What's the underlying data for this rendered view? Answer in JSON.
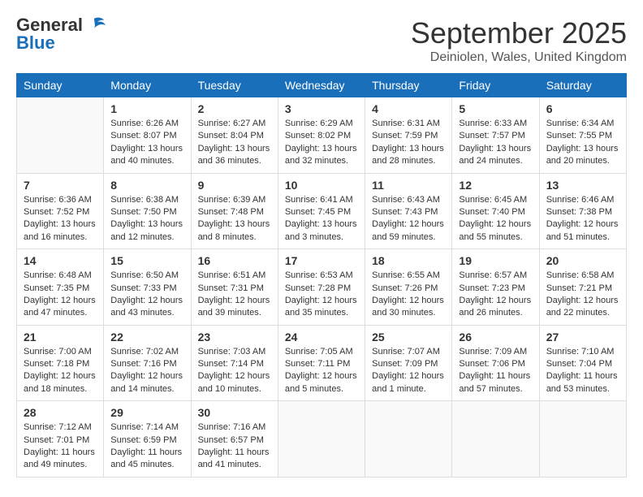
{
  "header": {
    "logo_general": "General",
    "logo_blue": "Blue",
    "month_title": "September 2025",
    "location": "Deiniolen, Wales, United Kingdom"
  },
  "days_of_week": [
    "Sunday",
    "Monday",
    "Tuesday",
    "Wednesday",
    "Thursday",
    "Friday",
    "Saturday"
  ],
  "weeks": [
    [
      {
        "day": "",
        "info": ""
      },
      {
        "day": "1",
        "info": "Sunrise: 6:26 AM\nSunset: 8:07 PM\nDaylight: 13 hours\nand 40 minutes."
      },
      {
        "day": "2",
        "info": "Sunrise: 6:27 AM\nSunset: 8:04 PM\nDaylight: 13 hours\nand 36 minutes."
      },
      {
        "day": "3",
        "info": "Sunrise: 6:29 AM\nSunset: 8:02 PM\nDaylight: 13 hours\nand 32 minutes."
      },
      {
        "day": "4",
        "info": "Sunrise: 6:31 AM\nSunset: 7:59 PM\nDaylight: 13 hours\nand 28 minutes."
      },
      {
        "day": "5",
        "info": "Sunrise: 6:33 AM\nSunset: 7:57 PM\nDaylight: 13 hours\nand 24 minutes."
      },
      {
        "day": "6",
        "info": "Sunrise: 6:34 AM\nSunset: 7:55 PM\nDaylight: 13 hours\nand 20 minutes."
      }
    ],
    [
      {
        "day": "7",
        "info": "Sunrise: 6:36 AM\nSunset: 7:52 PM\nDaylight: 13 hours\nand 16 minutes."
      },
      {
        "day": "8",
        "info": "Sunrise: 6:38 AM\nSunset: 7:50 PM\nDaylight: 13 hours\nand 12 minutes."
      },
      {
        "day": "9",
        "info": "Sunrise: 6:39 AM\nSunset: 7:48 PM\nDaylight: 13 hours\nand 8 minutes."
      },
      {
        "day": "10",
        "info": "Sunrise: 6:41 AM\nSunset: 7:45 PM\nDaylight: 13 hours\nand 3 minutes."
      },
      {
        "day": "11",
        "info": "Sunrise: 6:43 AM\nSunset: 7:43 PM\nDaylight: 12 hours\nand 59 minutes."
      },
      {
        "day": "12",
        "info": "Sunrise: 6:45 AM\nSunset: 7:40 PM\nDaylight: 12 hours\nand 55 minutes."
      },
      {
        "day": "13",
        "info": "Sunrise: 6:46 AM\nSunset: 7:38 PM\nDaylight: 12 hours\nand 51 minutes."
      }
    ],
    [
      {
        "day": "14",
        "info": "Sunrise: 6:48 AM\nSunset: 7:35 PM\nDaylight: 12 hours\nand 47 minutes."
      },
      {
        "day": "15",
        "info": "Sunrise: 6:50 AM\nSunset: 7:33 PM\nDaylight: 12 hours\nand 43 minutes."
      },
      {
        "day": "16",
        "info": "Sunrise: 6:51 AM\nSunset: 7:31 PM\nDaylight: 12 hours\nand 39 minutes."
      },
      {
        "day": "17",
        "info": "Sunrise: 6:53 AM\nSunset: 7:28 PM\nDaylight: 12 hours\nand 35 minutes."
      },
      {
        "day": "18",
        "info": "Sunrise: 6:55 AM\nSunset: 7:26 PM\nDaylight: 12 hours\nand 30 minutes."
      },
      {
        "day": "19",
        "info": "Sunrise: 6:57 AM\nSunset: 7:23 PM\nDaylight: 12 hours\nand 26 minutes."
      },
      {
        "day": "20",
        "info": "Sunrise: 6:58 AM\nSunset: 7:21 PM\nDaylight: 12 hours\nand 22 minutes."
      }
    ],
    [
      {
        "day": "21",
        "info": "Sunrise: 7:00 AM\nSunset: 7:18 PM\nDaylight: 12 hours\nand 18 minutes."
      },
      {
        "day": "22",
        "info": "Sunrise: 7:02 AM\nSunset: 7:16 PM\nDaylight: 12 hours\nand 14 minutes."
      },
      {
        "day": "23",
        "info": "Sunrise: 7:03 AM\nSunset: 7:14 PM\nDaylight: 12 hours\nand 10 minutes."
      },
      {
        "day": "24",
        "info": "Sunrise: 7:05 AM\nSunset: 7:11 PM\nDaylight: 12 hours\nand 5 minutes."
      },
      {
        "day": "25",
        "info": "Sunrise: 7:07 AM\nSunset: 7:09 PM\nDaylight: 12 hours\nand 1 minute."
      },
      {
        "day": "26",
        "info": "Sunrise: 7:09 AM\nSunset: 7:06 PM\nDaylight: 11 hours\nand 57 minutes."
      },
      {
        "day": "27",
        "info": "Sunrise: 7:10 AM\nSunset: 7:04 PM\nDaylight: 11 hours\nand 53 minutes."
      }
    ],
    [
      {
        "day": "28",
        "info": "Sunrise: 7:12 AM\nSunset: 7:01 PM\nDaylight: 11 hours\nand 49 minutes."
      },
      {
        "day": "29",
        "info": "Sunrise: 7:14 AM\nSunset: 6:59 PM\nDaylight: 11 hours\nand 45 minutes."
      },
      {
        "day": "30",
        "info": "Sunrise: 7:16 AM\nSunset: 6:57 PM\nDaylight: 11 hours\nand 41 minutes."
      },
      {
        "day": "",
        "info": ""
      },
      {
        "day": "",
        "info": ""
      },
      {
        "day": "",
        "info": ""
      },
      {
        "day": "",
        "info": ""
      }
    ]
  ]
}
